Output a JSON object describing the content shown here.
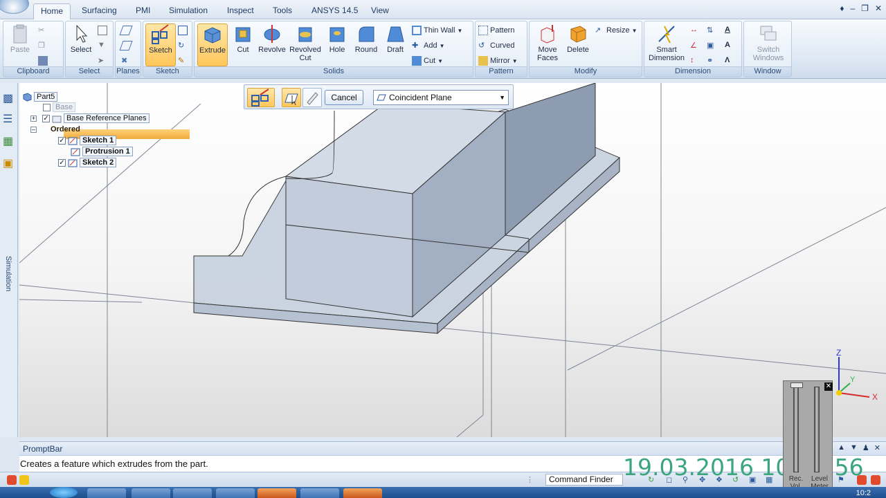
{
  "tabs": [
    {
      "label": "Home",
      "active": true
    },
    {
      "label": "Surfacing",
      "active": false
    },
    {
      "label": "PMI",
      "active": false
    },
    {
      "label": "Simulation",
      "active": false
    },
    {
      "label": "Inspect",
      "active": false
    },
    {
      "label": "Tools",
      "active": false
    },
    {
      "label": "ANSYS 14.5",
      "active": false
    },
    {
      "label": "View",
      "active": false
    }
  ],
  "ribbon": {
    "clipboard": {
      "label": "Clipboard",
      "paste": "Paste"
    },
    "select": {
      "label": "Select",
      "select": "Select"
    },
    "planes": {
      "label": "Planes"
    },
    "sketch": {
      "label": "Sketch",
      "sketch": "Sketch"
    },
    "solids": {
      "label": "Solids",
      "extrude": "Extrude",
      "cut": "Cut",
      "revolve": "Revolve",
      "revolved_cut_1": "Revolved",
      "revolved_cut_2": "Cut",
      "hole": "Hole",
      "round": "Round",
      "draft": "Draft",
      "thin_wall": "Thin Wall",
      "add": "Add",
      "cut_small": "Cut"
    },
    "pattern": {
      "label": "Pattern",
      "pattern": "Pattern",
      "curved": "Curved",
      "mirror": "Mirror"
    },
    "modify": {
      "label": "Modify",
      "move_faces_1": "Move",
      "move_faces_2": "Faces",
      "delete": "Delete",
      "resize": "Resize"
    },
    "dimension": {
      "label": "Dimension",
      "smart_1": "Smart",
      "smart_2": "Dimension"
    },
    "window": {
      "label": "Window",
      "switch_1": "Switch",
      "switch_2": "Windows"
    }
  },
  "left_toolbar": {
    "simulation_label": "Simulation"
  },
  "tree": {
    "root": "Part5",
    "base": "Base",
    "base_reference_planes": "Base Reference Planes",
    "ordered": "Ordered",
    "sketch1": "Sketch 1",
    "protrusion1": "Protrusion 1",
    "sketch2": "Sketch 2"
  },
  "command_bar": {
    "cancel": "Cancel",
    "plane_option": "Coincident Plane"
  },
  "prompt_bar": {
    "title": "PromptBar",
    "text": "Creates a feature which extrudes from the part."
  },
  "status_bar": {
    "command_finder": "Command Finder"
  },
  "triad": {
    "x": "X",
    "y": "Y",
    "z": "Z"
  },
  "overlay": {
    "timestamp": "19.03.2016 10:27:56"
  },
  "level_meter": {
    "rec_vol_1": "Rec.",
    "rec_vol_2": "Vol.",
    "level_meter_1": "Level",
    "level_meter_2": "Meter"
  },
  "taskbar": {
    "clock": "10:2"
  },
  "colors": {
    "highlight": "#ffc75a",
    "ribbon_blue": "#dde8f4",
    "tree_selected": "#203e72",
    "timestamp": "#3aa57f"
  }
}
